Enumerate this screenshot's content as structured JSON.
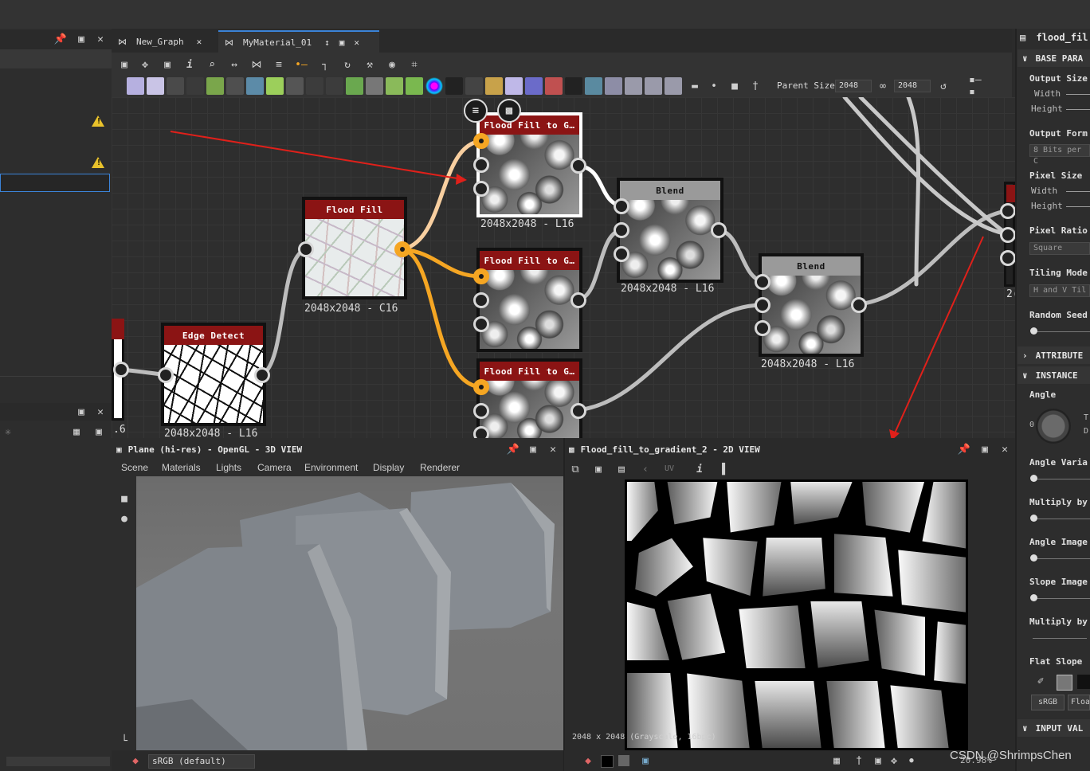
{
  "tabs": [
    {
      "label": "New_Graph"
    },
    {
      "label": "MyMaterial_01"
    }
  ],
  "toolbar": {
    "parent_size_label": "Parent Size:",
    "size_value_1": "2048",
    "size_value_2": "2048"
  },
  "nodes": {
    "flood_fill_to_g1": {
      "title": "Flood Fill to G…",
      "label": "2048x2048 - L16"
    },
    "flood_fill": {
      "title": "Flood Fill",
      "label": "2048x2048 - C16"
    },
    "blend1": {
      "title": "Blend",
      "label": "2048x2048 - L16"
    },
    "flood_fill_to_g2": {
      "title": "Flood Fill to G…"
    },
    "blend2": {
      "title": "Blend",
      "label": "2048x2048 - L16"
    },
    "edge_detect": {
      "title": "Edge Detect",
      "label": "2048x2048 - L16"
    },
    "flood_fill_to_g3": {
      "title": "Flood Fill to G…"
    },
    "partial_left_label": ".6",
    "partial_right_label": "2("
  },
  "view3d": {
    "title": "Plane (hi-res) - OpenGL - 3D VIEW",
    "menu": [
      "Scene",
      "Materials",
      "Lights",
      "Camera",
      "Environment",
      "Display",
      "Renderer"
    ],
    "colorspace": "sRGB (default)"
  },
  "view2d": {
    "title": "Flood_fill_to_gradient_2 - 2D VIEW",
    "uv_label": "UV",
    "info": "2048 x 2048 (Grayscale, 16bpc)",
    "zoom": "20.98%"
  },
  "properties": {
    "title": "flood_fil",
    "sections": {
      "base": "BASE PARA",
      "attributes": "ATTRIBUTE",
      "instance": "INSTANCE",
      "input_values": "INPUT VAL"
    },
    "output_size": "Output Size",
    "width": "Width",
    "height": "Height",
    "output_format": "Output Form",
    "output_format_value": "8 Bits per C",
    "pixel_size": "Pixel Size",
    "pixel_width": "Width",
    "pixel_height": "Height",
    "pixel_ratio": "Pixel Ratio",
    "pixel_ratio_value": "Square",
    "tiling_mode": "Tiling Mode",
    "tiling_mode_value": "H and V Til",
    "random_seed": "Random Seed",
    "angle": "Angle",
    "angle_zero": "0",
    "angle_t": "T",
    "angle_d": "D",
    "angle_variation": "Angle Varia",
    "multiply_by_1": "Multiply by",
    "angle_image": "Angle Image",
    "slope_image": "Slope Image",
    "multiply_by_2": "Multiply by",
    "flat_slope": "Flat Slope",
    "srgb": "sRGB",
    "float": "Floa"
  },
  "watermark": "CSDN @ShrimpsChen"
}
